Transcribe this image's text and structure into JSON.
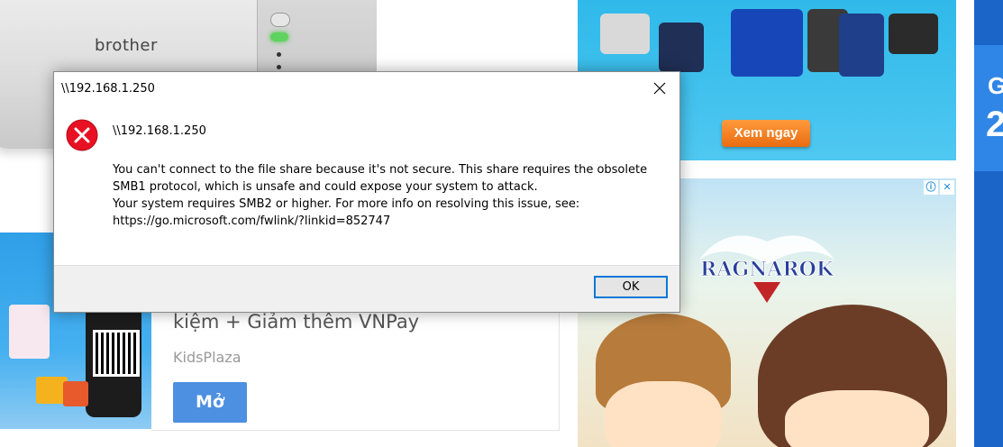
{
  "background": {
    "printer_ad": {
      "brand": "brother"
    },
    "pump_ad": {
      "cta_label": "Xem ngay"
    },
    "game_ad": {
      "logo_text": "RAGNAROK"
    },
    "kidsplaza_ad": {
      "headline": "kiệm + Giảm thêm VNPay",
      "source": "KidsPlaza",
      "open_label": "Mở"
    },
    "side_banner": {
      "text_top": "G",
      "text_big": "2"
    }
  },
  "dialog": {
    "title": "\\\\192.168.1.250",
    "heading": "\\\\192.168.1.250",
    "message_lines": [
      "You can't connect to the file share because it's not secure. This share requires the obsolete",
      "SMB1 protocol, which is unsafe and could expose your system to attack.",
      "Your system requires SMB2 or higher. For more info on resolving this issue, see:",
      "https://go.microsoft.com/fwlink/?linkid=852747"
    ],
    "ok_label": "OK",
    "icon": "error-icon",
    "colors": {
      "error": "#e81123",
      "focus_border": "#0078d7"
    }
  }
}
